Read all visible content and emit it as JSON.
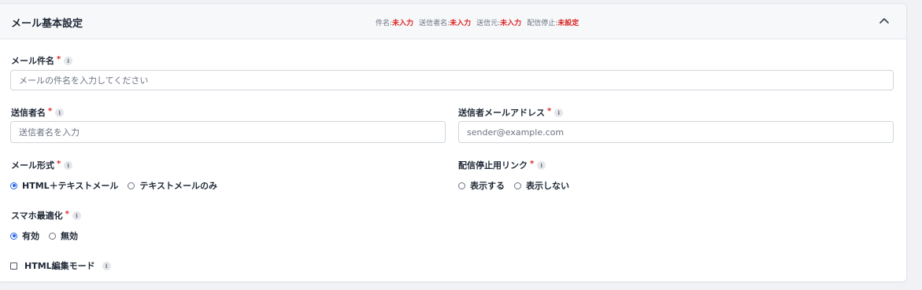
{
  "section": {
    "title": "メール基本設定",
    "summary": [
      {
        "label": "件名:",
        "value": "未入力"
      },
      {
        "label": "送信者名:",
        "value": "未入力"
      },
      {
        "label": "送信元:",
        "value": "未入力"
      },
      {
        "label": "配信停止:",
        "value": "未設定"
      }
    ],
    "collapse_icon": "chevron-up-icon"
  },
  "fields": {
    "subject": {
      "label": "メール件名",
      "required_mark": "*",
      "placeholder": "メールの件名を入力してください",
      "value": ""
    },
    "sender_name": {
      "label": "送信者名",
      "required_mark": "*",
      "placeholder": "送信者名を入力",
      "value": ""
    },
    "sender_email": {
      "label": "送信者メールアドレス",
      "required_mark": "*",
      "placeholder": "sender@example.com",
      "value": ""
    },
    "mail_format": {
      "label": "メール形式",
      "required_mark": "*",
      "options": [
        "HTML＋テキストメール",
        "テキストメールのみ"
      ],
      "selected": "HTML＋テキストメール"
    },
    "unsubscribe_link": {
      "label": "配信停止用リンク",
      "required_mark": "*",
      "options": [
        "表示する",
        "表示しない"
      ],
      "selected": ""
    },
    "mobile_optimize": {
      "label": "スマホ最適化",
      "required_mark": "*",
      "options": [
        "有効",
        "無効"
      ],
      "selected": "有効"
    },
    "html_edit_mode": {
      "label": "HTML編集モード",
      "checked": false
    }
  },
  "info_icon_glyph": "i",
  "colors": {
    "accent": "#2563eb",
    "required": "#dc2626",
    "header_bg": "#f7f8fa"
  }
}
